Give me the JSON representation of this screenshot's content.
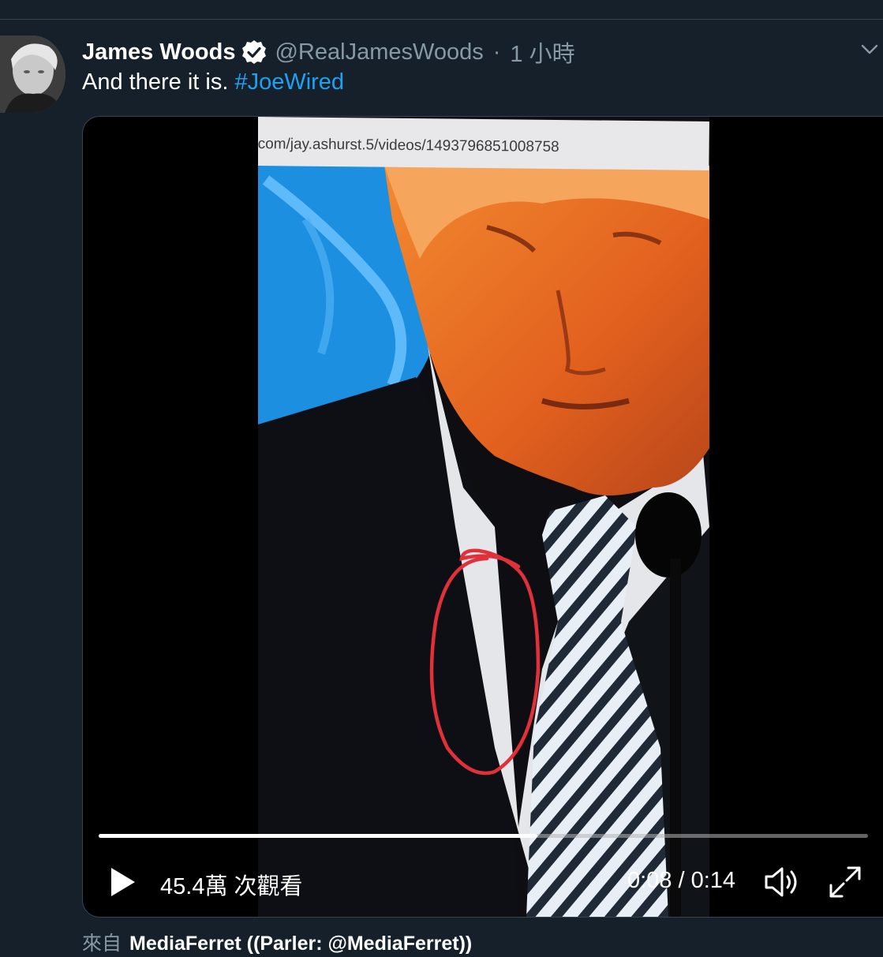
{
  "tweet": {
    "display_name": "James Woods",
    "handle": "@RealJamesWoods",
    "separator": "·",
    "timestamp": "1 小時",
    "text": "And there it is. ",
    "hashtag": "#JoeWired"
  },
  "media": {
    "url_overlay": "com/jay.ashurst.5/videos/1493796851008758",
    "views": "45.4萬 次觀看",
    "time": "0:08 / 0:14",
    "progress": 0.57
  },
  "source": {
    "prefix": "來自",
    "name": "MediaFerret ((Parler: @MediaFerret))"
  },
  "colors": {
    "background": "#15202b",
    "accent": "#1da1f2",
    "secondary_text": "#8899a6",
    "annotation_circle": "#e0303a"
  },
  "icons": {
    "verified": "verified-badge-icon",
    "caret": "chevron-down-icon",
    "play": "play-icon",
    "volume": "volume-icon",
    "fullscreen": "fullscreen-icon"
  }
}
